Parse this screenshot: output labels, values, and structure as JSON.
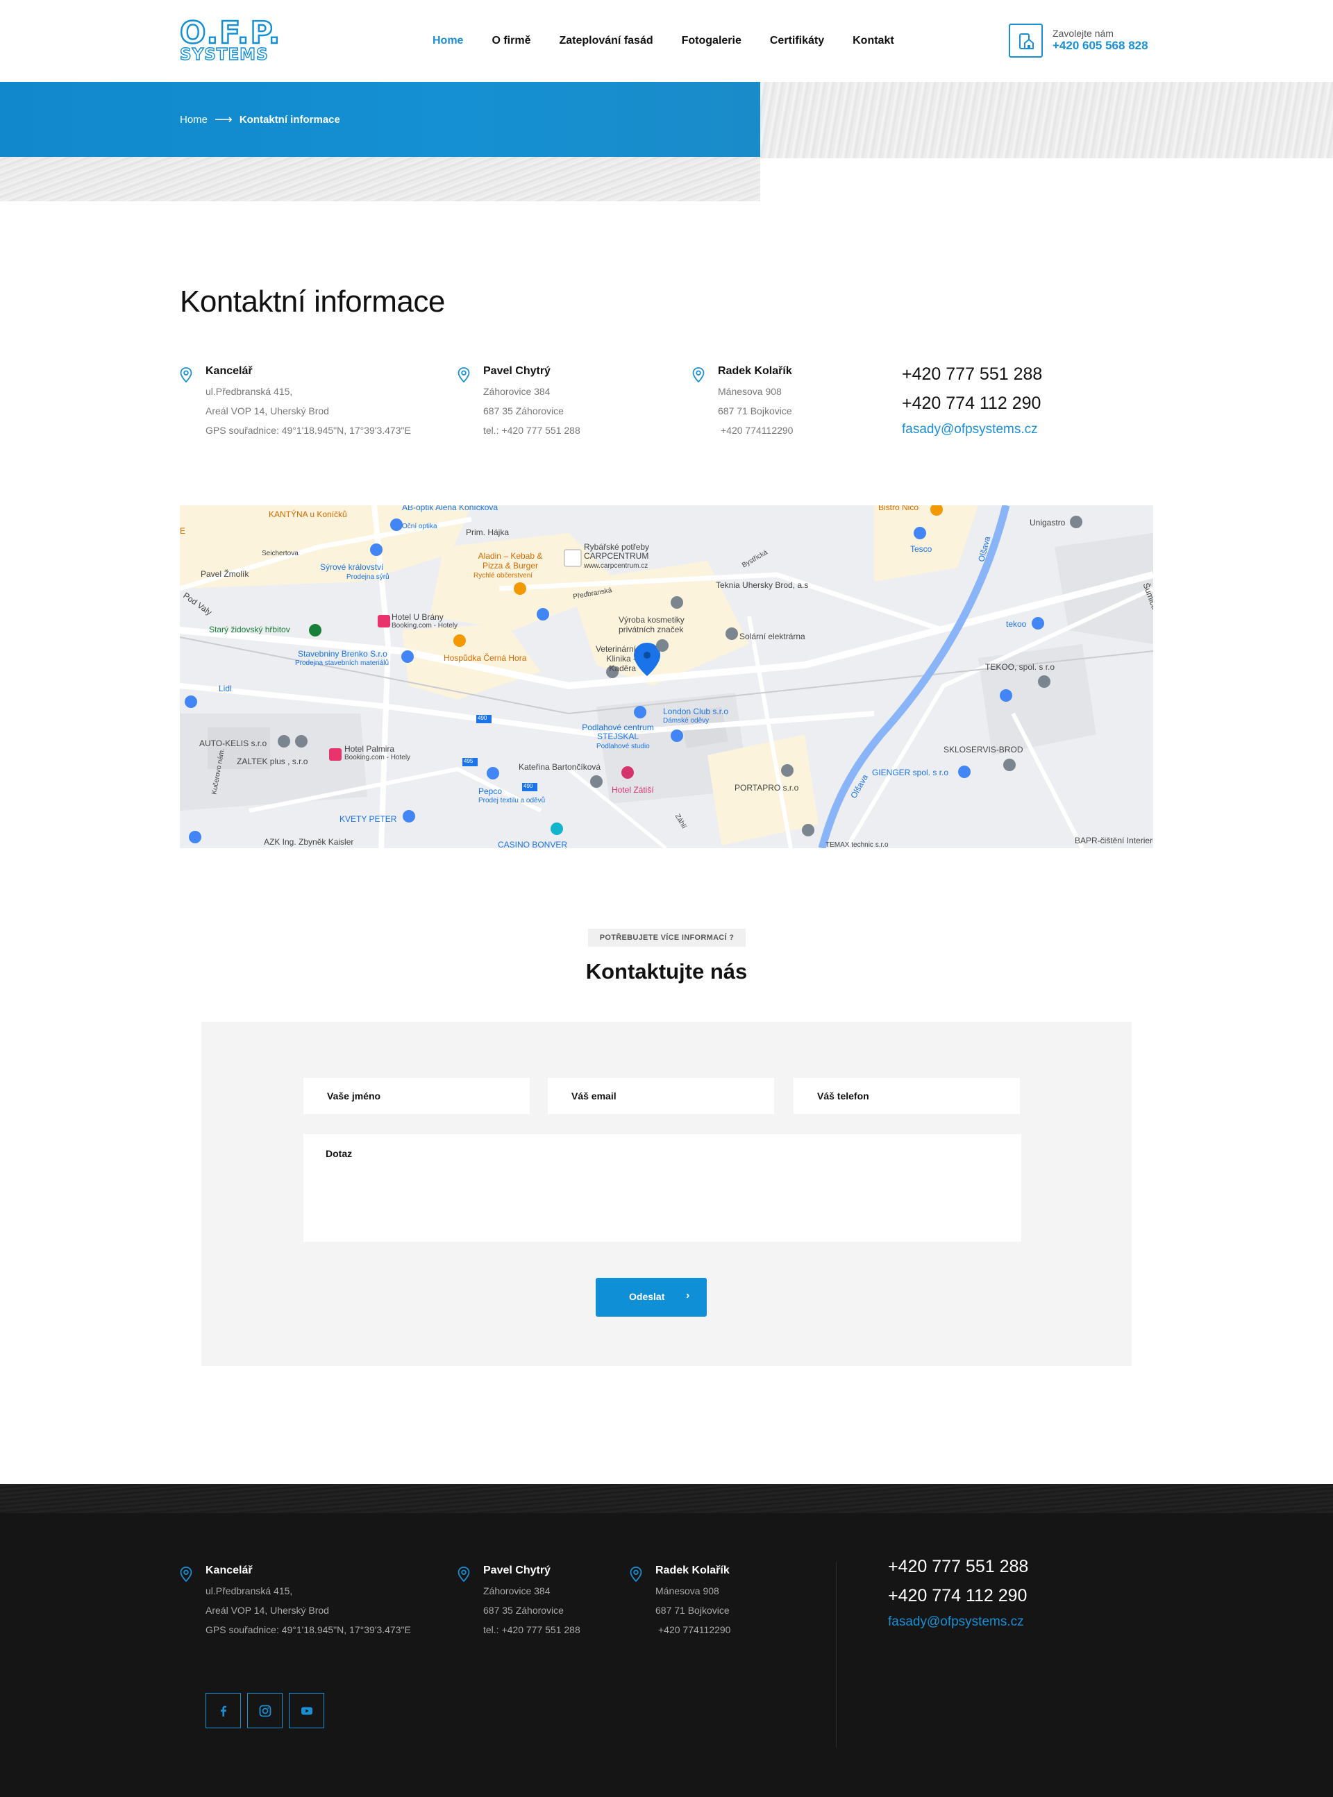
{
  "brand": {
    "logo_top": "O.F.P.",
    "logo_bottom": "SYSTEMS",
    "accent": "#1a8fd4"
  },
  "nav": [
    {
      "label": "Home",
      "active": true
    },
    {
      "label": "O firmě"
    },
    {
      "label": "Zateplování fasád"
    },
    {
      "label": "Fotogalerie"
    },
    {
      "label": "Certifikáty"
    },
    {
      "label": "Kontakt"
    }
  ],
  "call": {
    "label": "Zavolejte nám",
    "number": "+420 605 568 828",
    "icon": "phone-house-icon"
  },
  "breadcrumb": {
    "home": "Home",
    "arrow": "⟶",
    "current": "Kontaktní informace"
  },
  "page_title": "Kontaktní informace",
  "contacts": [
    {
      "name": "Kancelář",
      "lines": [
        "ul.Předbranská 415,",
        "Areál VOP 14, Uherský Brod",
        "GPS souřadnice: 49°1'18.945\"N, 17°39'3.473\"E"
      ]
    },
    {
      "name": "Pavel Chytrý",
      "lines": [
        "Záhorovice 384",
        "687 35 Záhorovice",
        "tel.: +420 777 551 288"
      ]
    },
    {
      "name": "Radek Kolařík",
      "lines": [
        "Mánesova 908",
        "687 71 Bojkovice",
        "+420 774112290"
      ]
    }
  ],
  "phones": [
    "+420 777 551 288",
    "+420 774 112 290"
  ],
  "email": "fasady@ofpsystems.cz",
  "map": {
    "labels": [
      "KANTÝNA u Koníčků",
      "AB-optik Alena Koníčková",
      "Oční optika",
      "Prim. Hájka",
      "Seichertova",
      "Sýrové království",
      "Prodejna sýrů",
      "Pavel Žmolík",
      "Aladin – Kebab & Pizza & Burger",
      "Rychlé občerstvení",
      "Rybářské potřeby CARPCENTRUM",
      "www.carpcentrum.cz",
      "Předbranská",
      "Bystřická",
      "Teknia Uhersky Brod, a.s",
      "Výroba kosmetiky privátních značek",
      "Solární elektrárna",
      "Veterinární Klinika - Kaděra",
      "Pod Valy",
      "Hotel U Brány",
      "Booking.com - Hotely",
      "Starý židovský hřbitov",
      "Hospůdka Černá Hora",
      "Stavebniny Brenko S.r.o",
      "Prodejna stavebních materiálů",
      "Lidl",
      "AUTO-KELIS s.r.o",
      "ZALTEK plus , s.r.o",
      "Hotel Palmira",
      "Booking.com - Hotely",
      "London Club s.r.o",
      "Dámské oděvy",
      "Podlahové centrum STEJSKAL",
      "Podlahové studio",
      "Kateřina Bartončíková",
      "Hotel Zátiší",
      "Pepco",
      "Prodej textilu a oděvů",
      "KVETY PETER",
      "AZK Ing. Zbyněk Kaisler",
      "CASINO BONVER",
      "Kučerovo nám.",
      "Bistro Nico",
      "Tesco",
      "Olšava",
      "Unigastro",
      "tekoo",
      "TEKOO, spol. s r.o",
      "SKLOSERVIS-BROD",
      "GIENGER spol. s r.o",
      "PORTAPRO s.r.o",
      "TEMAX technic s.r.o",
      "BAPR-čištění Interieru",
      "Šumice",
      "Záhlí",
      "490",
      "495",
      "490",
      "E",
      "Olšava"
    ]
  },
  "form": {
    "tagline": "POTŘEBUJETE VÍCE INFORMACÍ ?",
    "title": "Kontaktujte nás",
    "name_placeholder": "Vaše jméno",
    "email_placeholder": "Váš email",
    "phone_placeholder": "Váš telefon",
    "message_placeholder": "Dotaz",
    "submit": "Odeslat",
    "submit_icon": "›"
  },
  "footer": {
    "contacts": [
      {
        "name": "Kancelář",
        "lines": [
          "ul.Předbranská 415,",
          "Areál VOP 14, Uherský Brod",
          "GPS souřadnice: 49°1'18.945\"N, 17°39'3.473\"E"
        ]
      },
      {
        "name": "Pavel Chytrý",
        "lines": [
          "Záhorovice 384",
          "687 35 Záhorovice",
          "tel.: +420 777 551 288"
        ]
      },
      {
        "name": "Radek Kolařík",
        "lines": [
          "Mánesova 908",
          "687 71 Bojkovice",
          "+420 774112290"
        ]
      }
    ],
    "phones": [
      "+420 777 551 288",
      "+420 774 112 290"
    ],
    "email": "fasady@ofpsystems.cz",
    "social": [
      "facebook-icon",
      "instagram-icon",
      "youtube-icon"
    ]
  }
}
